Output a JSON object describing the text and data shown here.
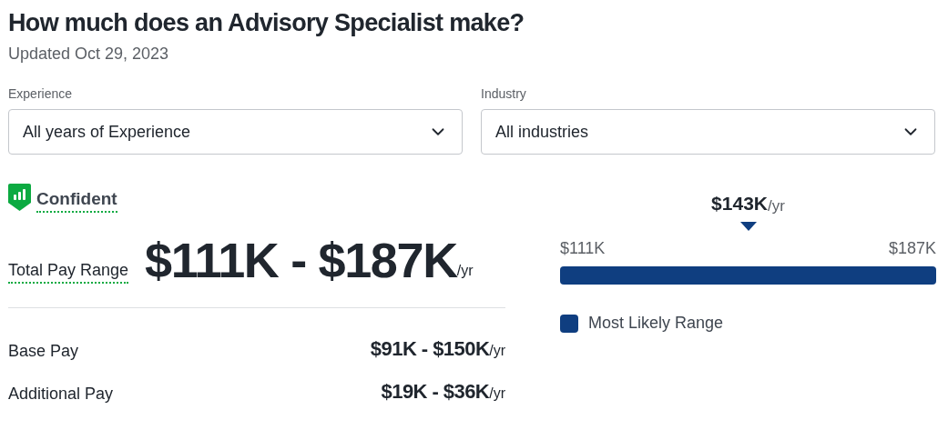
{
  "title": "How much does an Advisory Specialist make?",
  "updated": "Updated Oct 29, 2023",
  "filters": [
    {
      "label": "Experience",
      "value": "All years of Experience"
    },
    {
      "label": "Industry",
      "value": "All industries"
    }
  ],
  "confidence": {
    "label": "Confident"
  },
  "total_pay": {
    "label": "Total Pay Range",
    "amount": "$111K - $187K",
    "unit": "/yr"
  },
  "pay_rows": [
    {
      "label": "Base Pay",
      "amount": "$91K - $150K",
      "unit": "/yr"
    },
    {
      "label": "Additional Pay",
      "amount": "$19K - $36K",
      "unit": "/yr"
    }
  ],
  "range_bar": {
    "median": "$143K",
    "median_unit": "/yr",
    "low": "$111K",
    "high": "$187K",
    "color": "#0f3e80",
    "legend": "Most Likely Range"
  }
}
